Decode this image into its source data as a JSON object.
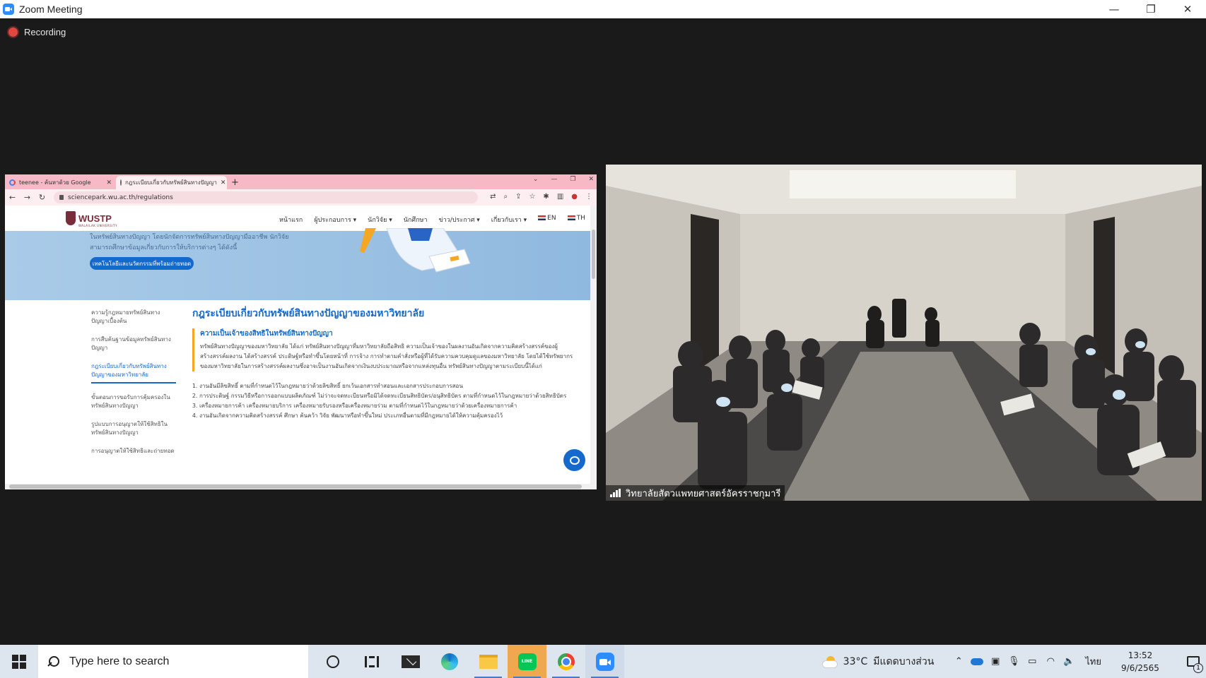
{
  "window": {
    "title": "Zoom Meeting",
    "minimize": "—",
    "restore": "❐",
    "close": "✕"
  },
  "recording": {
    "label": "Recording"
  },
  "browser": {
    "tabs": [
      {
        "label": "teenee - ค้นหาด้วย Google",
        "close": "✕"
      },
      {
        "label": "กฎระเบียบเกี่ยวกับทรัพย์สินทางปัญญา",
        "close": "✕"
      }
    ],
    "new_tab": "+",
    "url": "sciencepark.wu.ac.th/regulations",
    "site": {
      "logo": "WUSTP",
      "logo_sub": "WALAILAK UNIVERSITY",
      "menu": [
        "หน้าแรก",
        "ผู้ประกอบการ ▾",
        "นักวิจัย ▾",
        "นักศึกษา",
        "ข่าว/ประกาศ ▾",
        "เกี่ยวกับเรา ▾",
        "EN",
        "TH"
      ],
      "hero_text": "ในทรัพย์สินทางปัญญา โดยนักจัดการทรัพย์สินทางปัญญามืออาชีพ นักวิจัย สามารถศึกษาข้อมูลเกี่ยวกับการให้บริการต่างๆ ได้ดังนี้",
      "hero_button": "เทคโนโลยีและนวัตกรรมที่พร้อมถ่ายทอด",
      "side_links": [
        "ความรู้กฎหมายทรัพย์สินทางปัญญาเบื้องต้น",
        "การสืบค้นฐานข้อมูลทรัพย์สินทางปัญญา",
        "กฎระเบียบเกี่ยวกับทรัพย์สินทางปัญญาของมหาวิทยาลัย",
        "ขั้นตอนการขอรับการคุ้มครองในทรัพย์สินทางปัญญา",
        "รูปแบบการอนุญาตให้ใช้สิทธิในทรัพย์สินทางปัญญา",
        "การอนุญาตให้ใช้สิทธิและถ่ายทอด"
      ],
      "heading": "กฎระเบียบเกี่ยวกับทรัพย์สินทางปัญญาของมหาวิทยาลัย",
      "subheading": "ความเป็นเจ้าของสิทธิในทรัพย์สินทางปัญญา",
      "paragraph": "ทรัพย์สินทางปัญญาของมหาวิทยาลัย ได้แก่ ทรัพย์สินทางปัญญาที่มหาวิทยาลัยถือสิทธิ ความเป็นเจ้าของในผลงานอันเกิดจากความคิดสร้างสรรค์ของผู้สร้างสรรค์ผลงาน ได้สร้างสรรค์ ประดิษฐ์หรือทำขึ้นโดยหน้าที่ การจ้าง การทำตามคำสั่งหรือผู้ที่ได้รับความควบคุมดูแลของมหาวิทยาลัย โดยได้ใช้ทรัพยากรของมหาวิทยาลัยในการสร้างสรรค์ผลงานซึ่งอาจเป็นงานอันเกิดจากเงินงบประมาณหรือจากแหล่งทุนอื่น ทรัพย์สินทางปัญญาตามระเบียบนี้ได้แก่",
      "list": [
        "งานอันมีลิขสิทธิ์ ตามที่กำหนดไว้ในกฎหมายว่าด้วยลิขสิทธิ์ ยกเว้นเอกสารทำสอนและเอกสารประกอบการสอน",
        "การประดิษฐ์ กรรมวิธีหรือการออกแบบผลิตภัณฑ์ ไม่ว่าจะจดทะเบียนหรือมิได้จดทะเบียนสิทธิบัตร/อนุสิทธิบัตร ตามที่กำหนดไว้ในกฎหมายว่าด้วยสิทธิบัตร",
        "เครื่องหมายการค้า เครื่องหมายบริการ เครื่องหมายรับรองหรือเครื่องหมายร่วม ตามที่กำหนดไว้ในกฎหมายว่าด้วยเครื่องหมายการค้า",
        "งานอันเกิดจากความคิดสร้างสรรค์ ศึกษา ค้นคว้า วิจัย พัฒนาหรือทำขึ้นใหม่ ประเภทอื่นตามที่มีกฎหมายได้ให้ความคุ้มครองไว้"
      ]
    }
  },
  "video": {
    "participant": "วิทยาลัยสัตวแพทยศาสตร์อัครราชกุมารี"
  },
  "taskbar": {
    "search_placeholder": "Type here to search",
    "line_label": "LINE",
    "weather_temp": "33°C",
    "weather_desc": "มีแดดบางส่วน",
    "lang": "ไทย",
    "time": "13:52",
    "date": "9/6/2565",
    "notification_count": "1"
  }
}
